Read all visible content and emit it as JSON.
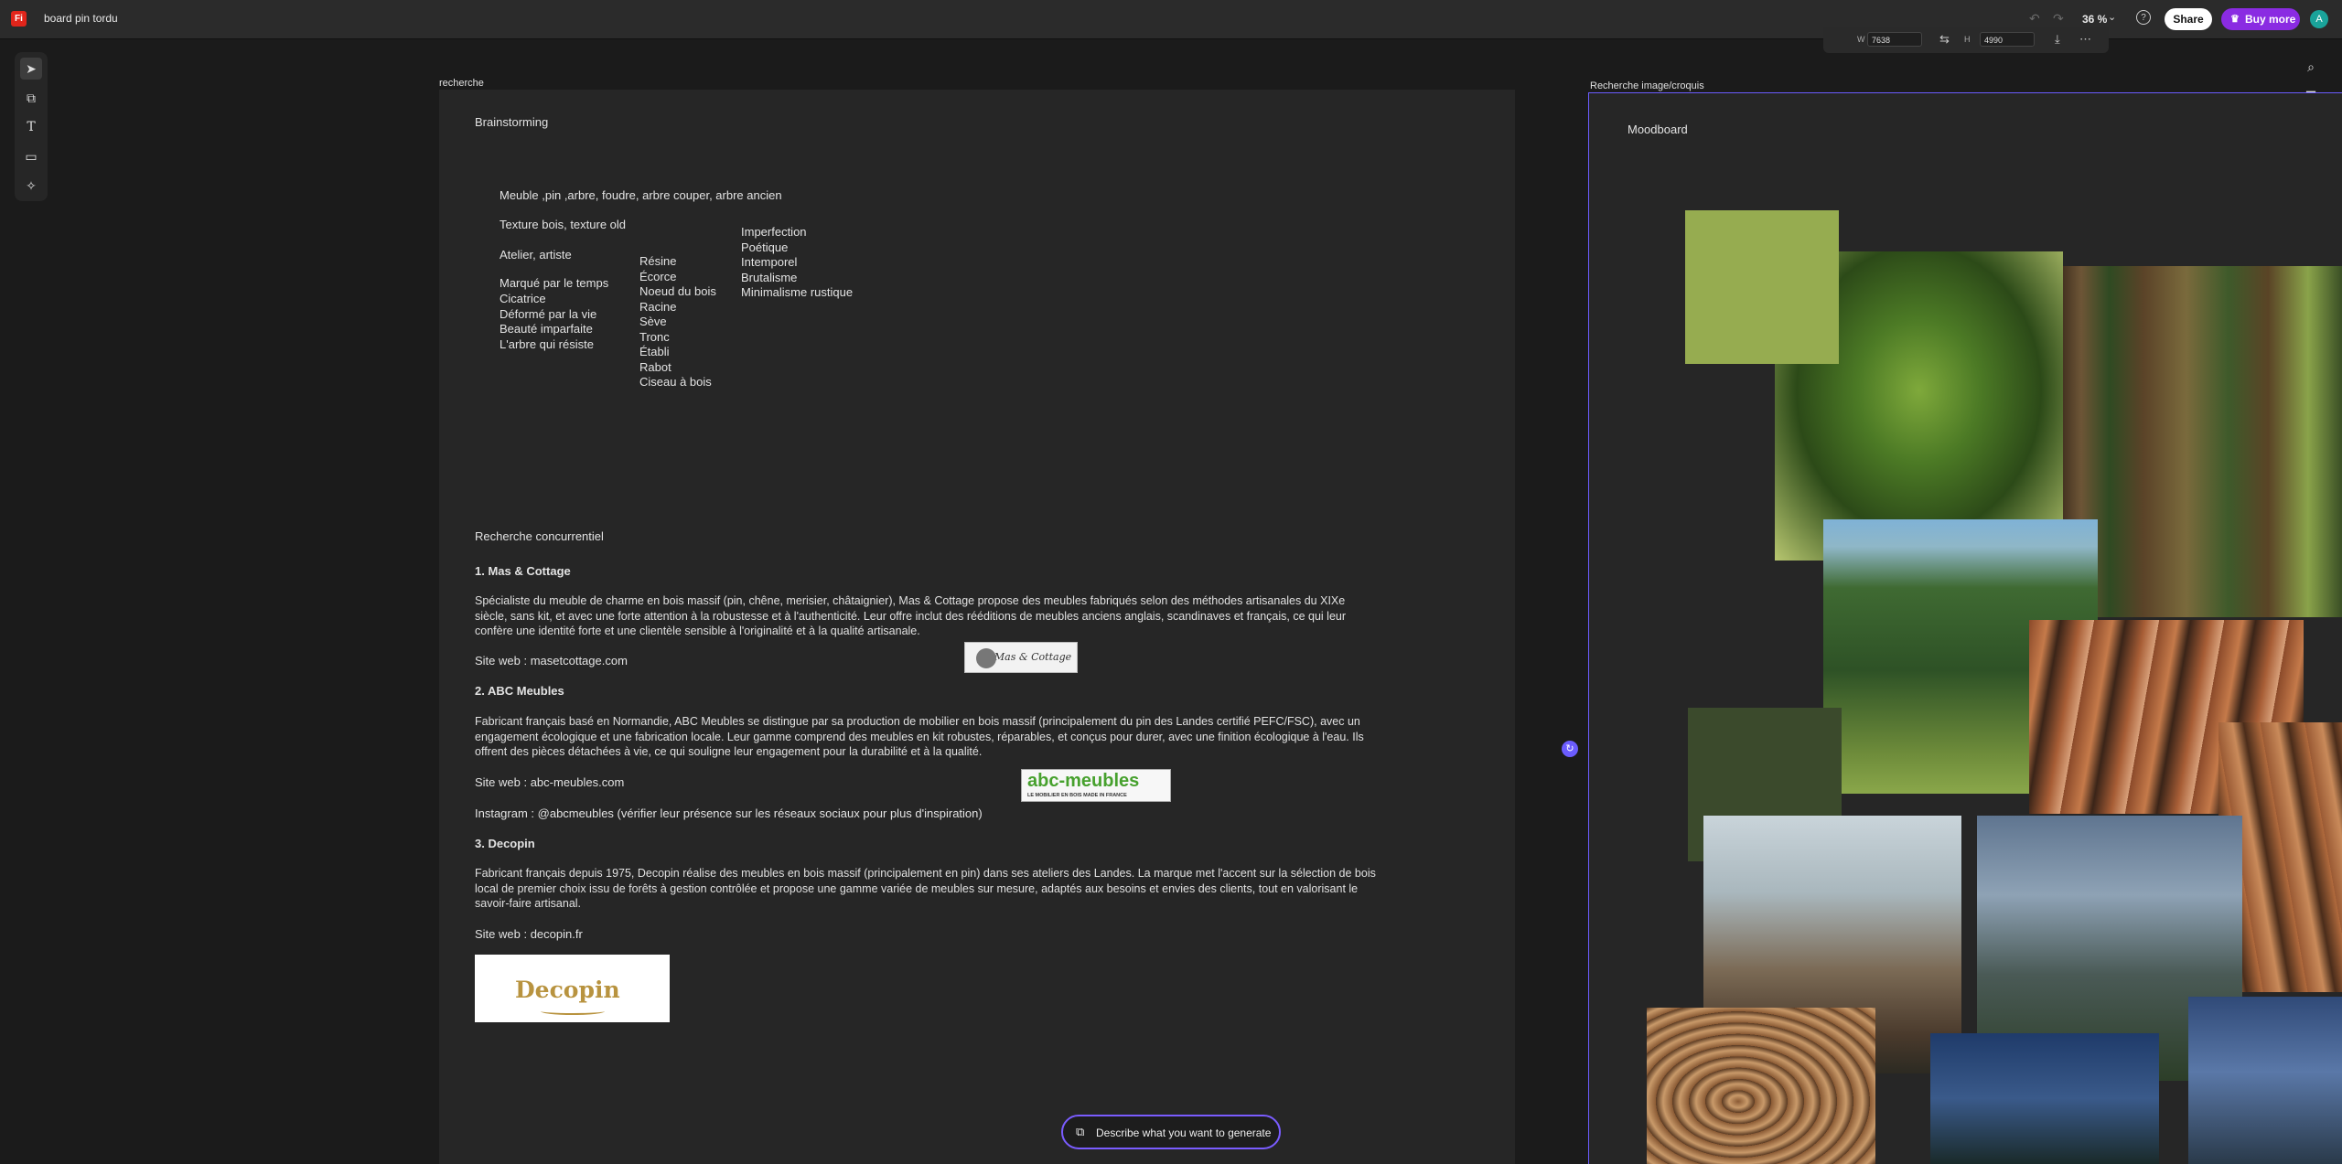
{
  "app": {
    "logo_text": "Fi",
    "document_title": "board pin tordu",
    "zoom": "36 %",
    "share_label": "Share",
    "buy_label": "Buy more",
    "avatar_initial": "A",
    "brand_color": "#e1251b",
    "accent_color": "#6b5cff"
  },
  "properties": {
    "w_label": "W",
    "w_value": "7638",
    "h_label": "H",
    "h_value": "4990"
  },
  "artboards": {
    "left_label": "recherche",
    "right_label": "Recherche image/croquis"
  },
  "brainstorm": {
    "title": "Brainstorming",
    "line1": "Meuble ,pin ,arbre, foudre, arbre couper, arbre ancien",
    "line2": "Texture bois, texture old",
    "line3": "Atelier, artiste",
    "col1": [
      "Marqué par le temps",
      "Cicatrice",
      "Déformé par la vie",
      "Beauté imparfaite",
      "L'arbre qui résiste"
    ],
    "col2": [
      "Résine",
      "Écorce",
      "Noeud du bois",
      "Racine",
      "Sève",
      "Tronc",
      "Établi",
      "Rabot",
      "Ciseau à bois"
    ],
    "col3": [
      "Imperfection",
      "Poétique",
      "Intemporel",
      "Brutalisme",
      "Minimalisme rustique"
    ]
  },
  "competitors": {
    "title": "Recherche concurrentiel",
    "c1_title": "1. Mas & Cottage",
    "c1_text": "Spécialiste du meuble de charme en bois massif (pin, chêne, merisier, châtaignier), Mas & Cottage propose des meubles fabriqués selon des méthodes artisanales du XIXe siècle, sans kit, et avec une forte attention à la robustesse et à l'authenticité. Leur offre inclut des rééditions de meubles anciens anglais, scandinaves et français, ce qui leur confère une identité forte et une clientèle sensible à l'originalité et à la qualité artisanale.",
    "c1_site": "Site web : masetcottage.com",
    "c1_logo": "Mas & Cottage",
    "c2_title": "2. ABC Meubles",
    "c2_text": "Fabricant français basé en Normandie, ABC Meubles se distingue par sa production de mobilier en bois massif (principalement du pin des Landes certifié PEFC/FSC), avec un engagement écologique et une fabrication locale. Leur gamme comprend des meubles en kit robustes, réparables, et conçus pour durer, avec une finition écologique à l'eau. Ils offrent des pièces détachées à vie, ce qui souligne leur engagement pour la durabilité et à la qualité.",
    "c2_site": "Site web : abc-meubles.com",
    "c2_instagram": "Instagram : @abcmeubles (vérifier leur présence sur les réseaux sociaux pour plus d'inspiration)",
    "c2_logo": "abc-meubles",
    "c2_logo_sub": "LE MOBILIER EN BOIS MADE IN FRANCE",
    "c3_title": "3. Decopin",
    "c3_text": "Fabricant français depuis 1975, Decopin réalise des meubles en bois massif (principalement en pin) dans ses ateliers des Landes. La marque met l'accent sur la sélection de bois local de premier choix issu de forêts à gestion contrôlée et propose une gamme variée de meubles sur mesure, adaptés aux besoins et envies des clients, tout en valorisant le savoir-faire artisanal.",
    "c3_site": "Site web : decopin.fr",
    "c3_logo": "Decopin"
  },
  "moodboard": {
    "title": "Moodboard",
    "swatch1": "#96ac50",
    "swatch2": "#3b4a2c"
  },
  "generate": {
    "label": "Describe what you want to generate"
  }
}
